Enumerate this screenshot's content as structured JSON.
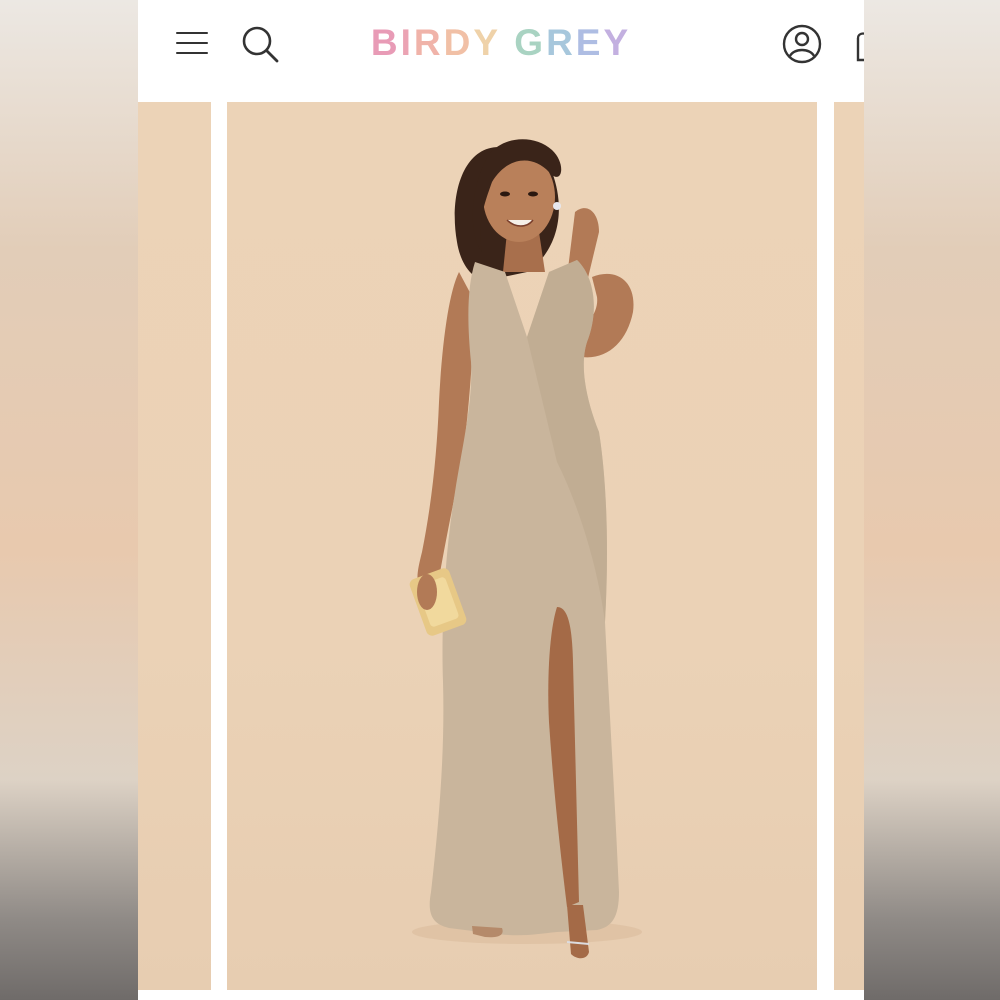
{
  "brand": {
    "logo_letters": [
      {
        "ch": "B",
        "color": "#e89bb6"
      },
      {
        "ch": "I",
        "color": "#eba3b3"
      },
      {
        "ch": "R",
        "color": "#f0b3a9"
      },
      {
        "ch": "D",
        "color": "#f1c0a6"
      },
      {
        "ch": "Y",
        "color": "#efd2a9"
      },
      {
        "ch": " ",
        "color": "#ffffff"
      },
      {
        "ch": "G",
        "color": "#a9d3c2"
      },
      {
        "ch": "R",
        "color": "#a7c7dc"
      },
      {
        "ch": "E",
        "color": "#aebde3"
      },
      {
        "ch": "Y",
        "color": "#c3b0e0"
      }
    ]
  },
  "header": {
    "icons": {
      "menu": "hamburger-menu-icon",
      "search": "search-icon",
      "account": "account-icon",
      "cart": "cart-icon"
    }
  },
  "gallery": {
    "main_image": "model-in-long-taupe-v-neck-dress-with-slit"
  },
  "colors": {
    "backdrop": "#ebd2b6",
    "dress": "#c9b59c",
    "skin": "#b27a56",
    "hair": "#3a2419"
  }
}
